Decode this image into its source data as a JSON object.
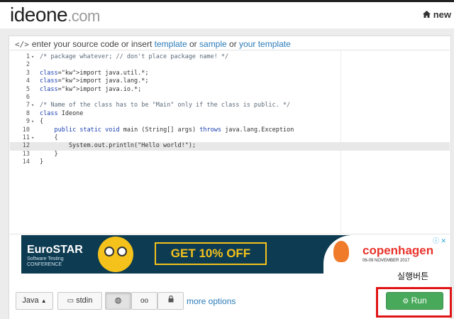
{
  "header": {
    "logo_main": "ideone",
    "logo_tld": ".com",
    "home_icon": "home-icon",
    "new_label": "new"
  },
  "hint": {
    "icon": "code-icon",
    "prefix": "enter your source code or insert ",
    "link_template": "template",
    "or1": " or ",
    "link_sample": "sample",
    "or2": " or ",
    "link_your_template": "your template"
  },
  "editor": {
    "active_line": 12,
    "lines": [
      {
        "n": "1",
        "fold": "▾",
        "text": "/* package whatever; // don't place package name! */"
      },
      {
        "n": "2",
        "fold": "",
        "text": ""
      },
      {
        "n": "3",
        "fold": "",
        "text": "import java.util.*;"
      },
      {
        "n": "4",
        "fold": "",
        "text": "import java.lang.*;"
      },
      {
        "n": "5",
        "fold": "",
        "text": "import java.io.*;"
      },
      {
        "n": "6",
        "fold": "",
        "text": ""
      },
      {
        "n": "7",
        "fold": "▾",
        "text": "/* Name of the class has to be \"Main\" only if the class is public. */"
      },
      {
        "n": "8",
        "fold": "",
        "text": "class Ideone"
      },
      {
        "n": "9",
        "fold": "▾",
        "text": "{"
      },
      {
        "n": "10",
        "fold": "",
        "text": "    public static void main (String[] args) throws java.lang.Exception"
      },
      {
        "n": "11",
        "fold": "▾",
        "text": "    {"
      },
      {
        "n": "12",
        "fold": "",
        "text": "        System.out.println(\"Hello world!\");"
      },
      {
        "n": "13",
        "fold": "",
        "text": "    }"
      },
      {
        "n": "14",
        "fold": "",
        "text": "}"
      }
    ]
  },
  "ad": {
    "brand": "EuroSTAR",
    "brand_sub1": "Software Testing",
    "brand_sub2": "CONFERENCE",
    "offer": "GET 10% OFF",
    "city": "copenhagen",
    "dates": "06-09    NOVEMBER    2017",
    "adchoices": "ⓘ ✕"
  },
  "annotation": "실행버튼",
  "toolbar": {
    "language": "Java",
    "stdin": "stdin",
    "more_options": "more options",
    "run": "Run"
  },
  "colors": {
    "run_green": "#49a95a",
    "highlight_red": "#e01414",
    "link_blue": "#2a7ab8"
  }
}
